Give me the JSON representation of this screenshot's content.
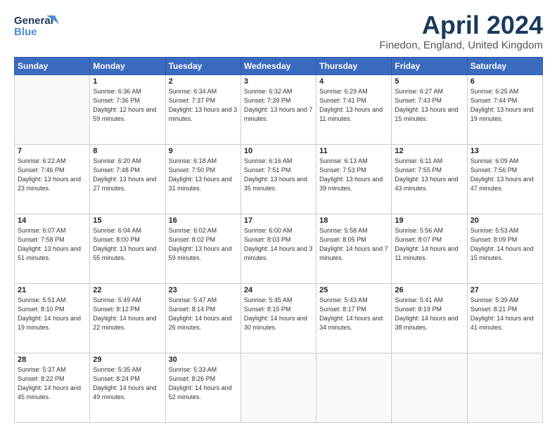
{
  "header": {
    "logo_line1": "General",
    "logo_line2": "Blue",
    "month_title": "April 2024",
    "location": "Finedon, England, United Kingdom"
  },
  "weekdays": [
    "Sunday",
    "Monday",
    "Tuesday",
    "Wednesday",
    "Thursday",
    "Friday",
    "Saturday"
  ],
  "weeks": [
    [
      {
        "day": "",
        "empty": true
      },
      {
        "day": "1",
        "sunrise": "6:36 AM",
        "sunset": "7:36 PM",
        "daylight": "12 hours and 59 minutes."
      },
      {
        "day": "2",
        "sunrise": "6:34 AM",
        "sunset": "7:37 PM",
        "daylight": "13 hours and 3 minutes."
      },
      {
        "day": "3",
        "sunrise": "6:32 AM",
        "sunset": "7:39 PM",
        "daylight": "13 hours and 7 minutes."
      },
      {
        "day": "4",
        "sunrise": "6:29 AM",
        "sunset": "7:41 PM",
        "daylight": "13 hours and 11 minutes."
      },
      {
        "day": "5",
        "sunrise": "6:27 AM",
        "sunset": "7:43 PM",
        "daylight": "13 hours and 15 minutes."
      },
      {
        "day": "6",
        "sunrise": "6:25 AM",
        "sunset": "7:44 PM",
        "daylight": "13 hours and 19 minutes."
      }
    ],
    [
      {
        "day": "7",
        "sunrise": "6:22 AM",
        "sunset": "7:46 PM",
        "daylight": "13 hours and 23 minutes."
      },
      {
        "day": "8",
        "sunrise": "6:20 AM",
        "sunset": "7:48 PM",
        "daylight": "13 hours and 27 minutes."
      },
      {
        "day": "9",
        "sunrise": "6:18 AM",
        "sunset": "7:50 PM",
        "daylight": "13 hours and 31 minutes."
      },
      {
        "day": "10",
        "sunrise": "6:16 AM",
        "sunset": "7:51 PM",
        "daylight": "13 hours and 35 minutes."
      },
      {
        "day": "11",
        "sunrise": "6:13 AM",
        "sunset": "7:53 PM",
        "daylight": "13 hours and 39 minutes."
      },
      {
        "day": "12",
        "sunrise": "6:11 AM",
        "sunset": "7:55 PM",
        "daylight": "13 hours and 43 minutes."
      },
      {
        "day": "13",
        "sunrise": "6:09 AM",
        "sunset": "7:56 PM",
        "daylight": "13 hours and 47 minutes."
      }
    ],
    [
      {
        "day": "14",
        "sunrise": "6:07 AM",
        "sunset": "7:58 PM",
        "daylight": "13 hours and 51 minutes."
      },
      {
        "day": "15",
        "sunrise": "6:04 AM",
        "sunset": "8:00 PM",
        "daylight": "13 hours and 55 minutes."
      },
      {
        "day": "16",
        "sunrise": "6:02 AM",
        "sunset": "8:02 PM",
        "daylight": "13 hours and 59 minutes."
      },
      {
        "day": "17",
        "sunrise": "6:00 AM",
        "sunset": "8:03 PM",
        "daylight": "14 hours and 3 minutes."
      },
      {
        "day": "18",
        "sunrise": "5:58 AM",
        "sunset": "8:05 PM",
        "daylight": "14 hours and 7 minutes."
      },
      {
        "day": "19",
        "sunrise": "5:56 AM",
        "sunset": "8:07 PM",
        "daylight": "14 hours and 11 minutes."
      },
      {
        "day": "20",
        "sunrise": "5:53 AM",
        "sunset": "8:09 PM",
        "daylight": "14 hours and 15 minutes."
      }
    ],
    [
      {
        "day": "21",
        "sunrise": "5:51 AM",
        "sunset": "8:10 PM",
        "daylight": "14 hours and 19 minutes."
      },
      {
        "day": "22",
        "sunrise": "5:49 AM",
        "sunset": "8:12 PM",
        "daylight": "14 hours and 22 minutes."
      },
      {
        "day": "23",
        "sunrise": "5:47 AM",
        "sunset": "8:14 PM",
        "daylight": "14 hours and 26 minutes."
      },
      {
        "day": "24",
        "sunrise": "5:45 AM",
        "sunset": "8:15 PM",
        "daylight": "14 hours and 30 minutes."
      },
      {
        "day": "25",
        "sunrise": "5:43 AM",
        "sunset": "8:17 PM",
        "daylight": "14 hours and 34 minutes."
      },
      {
        "day": "26",
        "sunrise": "5:41 AM",
        "sunset": "8:19 PM",
        "daylight": "14 hours and 38 minutes."
      },
      {
        "day": "27",
        "sunrise": "5:39 AM",
        "sunset": "8:21 PM",
        "daylight": "14 hours and 41 minutes."
      }
    ],
    [
      {
        "day": "28",
        "sunrise": "5:37 AM",
        "sunset": "8:22 PM",
        "daylight": "14 hours and 45 minutes."
      },
      {
        "day": "29",
        "sunrise": "5:35 AM",
        "sunset": "8:24 PM",
        "daylight": "14 hours and 49 minutes."
      },
      {
        "day": "30",
        "sunrise": "5:33 AM",
        "sunset": "8:26 PM",
        "daylight": "14 hours and 52 minutes."
      },
      {
        "day": "",
        "empty": true
      },
      {
        "day": "",
        "empty": true
      },
      {
        "day": "",
        "empty": true
      },
      {
        "day": "",
        "empty": true
      }
    ]
  ],
  "labels": {
    "sunrise": "Sunrise:",
    "sunset": "Sunset:",
    "daylight": "Daylight:"
  }
}
